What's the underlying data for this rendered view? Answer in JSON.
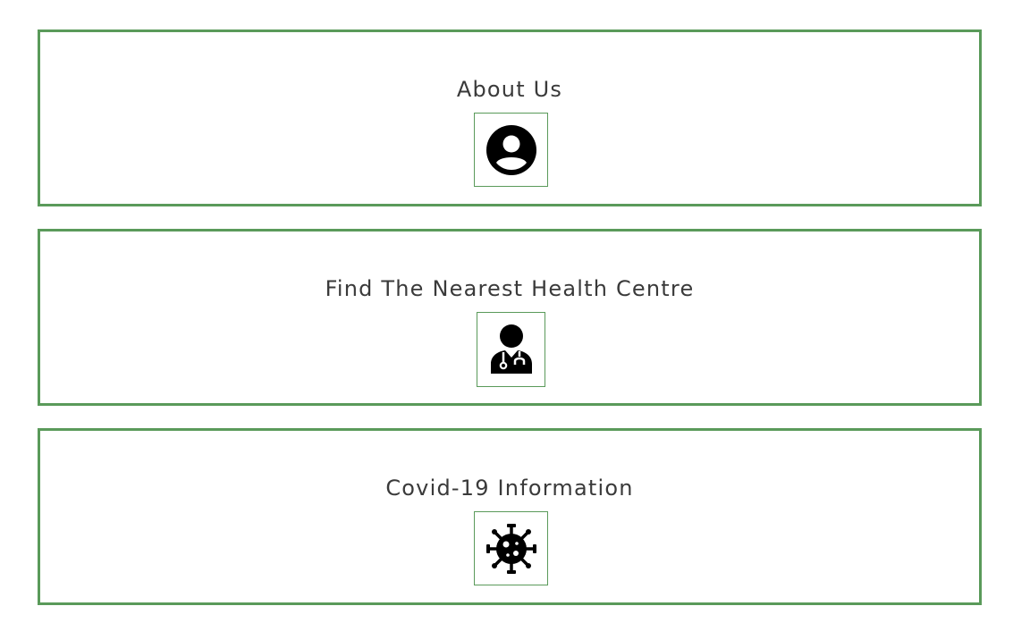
{
  "cards": [
    {
      "title": "About Us",
      "icon": "user-circle-icon"
    },
    {
      "title": "Find The Nearest Health Centre",
      "icon": "doctor-icon"
    },
    {
      "title": "Covid-19 Information",
      "icon": "virus-icon"
    }
  ],
  "colors": {
    "border": "#5a9a5a",
    "text": "#3a3a3a",
    "icon": "#000000",
    "background": "#ffffff"
  }
}
